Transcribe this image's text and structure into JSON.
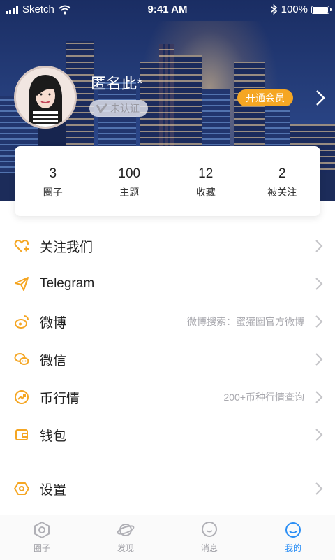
{
  "status_bar": {
    "carrier": "Sketch",
    "time": "9:41 AM",
    "battery": "100%"
  },
  "profile": {
    "username": "匿名此*",
    "verify_label": "未认证",
    "vip_label": "开通会员"
  },
  "stats": [
    {
      "value": "3",
      "label": "圈子"
    },
    {
      "value": "100",
      "label": "主题"
    },
    {
      "value": "12",
      "label": "收藏"
    },
    {
      "value": "2",
      "label": "被关注"
    }
  ],
  "menu": [
    {
      "label": "关注我们",
      "hint": "",
      "icon": "heart-plus-icon"
    },
    {
      "label": "Telegram",
      "hint": "",
      "icon": "paper-plane-icon"
    },
    {
      "label": "微博",
      "hint": "微博搜索：蜜獾圈官方微博",
      "icon": "weibo-icon"
    },
    {
      "label": "微信",
      "hint": "",
      "icon": "wechat-icon"
    },
    {
      "label": "币行情",
      "hint": "200+币种行情查询",
      "icon": "trend-icon"
    },
    {
      "label": "钱包",
      "hint": "",
      "icon": "wallet-icon"
    }
  ],
  "settings": {
    "label": "设置",
    "icon": "settings-hexagon-icon"
  },
  "tabs": [
    {
      "label": "圈子",
      "icon": "hexagon-icon",
      "active": false
    },
    {
      "label": "发现",
      "icon": "planet-icon",
      "active": false
    },
    {
      "label": "消息",
      "icon": "message-icon",
      "active": false
    },
    {
      "label": "我的",
      "icon": "profile-smile-icon",
      "active": true
    }
  ],
  "colors": {
    "accent_orange": "#f5a623",
    "tab_active": "#2c8ff5",
    "tab_inactive": "#a0a0a6"
  }
}
